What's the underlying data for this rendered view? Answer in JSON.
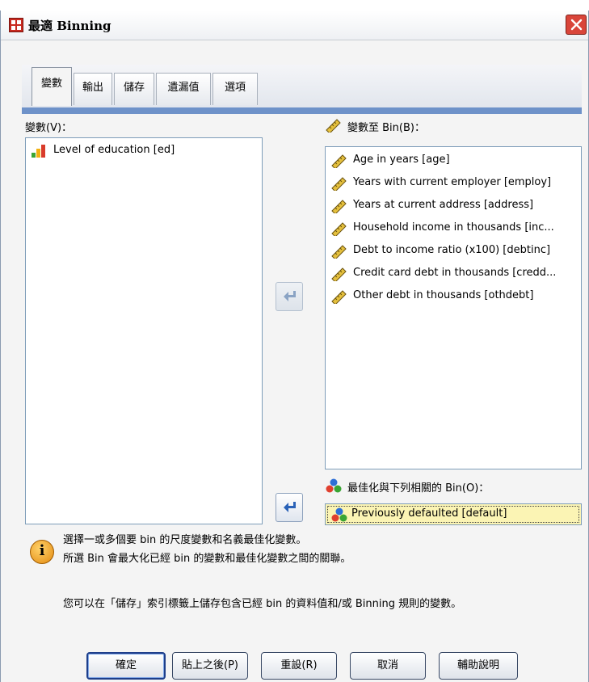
{
  "window": {
    "title": "最適 Binning",
    "close_label": "Close"
  },
  "tabs": [
    {
      "label": "變數"
    },
    {
      "label": "輸出"
    },
    {
      "label": "儲存"
    },
    {
      "label": "遺漏值"
    },
    {
      "label": "選項"
    }
  ],
  "variables": {
    "label": "變數(V)：",
    "items": [
      {
        "label": "Level of education [ed]",
        "icon": "ordinal-bar-icon"
      }
    ]
  },
  "bin": {
    "label": "變數至 Bin(B)：",
    "items": [
      {
        "label": "Age in years [age]",
        "icon": "ruler-icon"
      },
      {
        "label": "Years with current employer [employ]",
        "icon": "ruler-icon"
      },
      {
        "label": "Years at current address [address]",
        "icon": "ruler-icon"
      },
      {
        "label": "Household income in thousands [inc...",
        "icon": "ruler-icon"
      },
      {
        "label": "Debt to income ratio (x100) [debtinc]",
        "icon": "ruler-icon"
      },
      {
        "label": "Credit card debt in thousands [credd...",
        "icon": "ruler-icon"
      },
      {
        "label": "Other debt in thousands [othdebt]",
        "icon": "ruler-icon"
      }
    ]
  },
  "optimize": {
    "label": "最佳化與下列相關的 Bin(O)：",
    "value": "Previously defaulted [default]"
  },
  "info": {
    "line1": "選擇一或多個要 bin 的尺度變數和名義最佳化變數。",
    "line2": "所選 Bin 會最大化已經 bin 的變數和最佳化變數之間的關聯。",
    "line3": "您可以在「儲存」索引標籤上儲存包含已經 bin 的資料值和/或 Binning 規則的變數。"
  },
  "buttons": {
    "ok": "確定",
    "paste": "貼上之後(P)",
    "reset": "重設(R)",
    "cancel": "取消",
    "help": "輔助說明"
  },
  "colors": {
    "accent": "#6e92c9",
    "target_bg": "#fbf4b4",
    "list_border": "#7e9db9"
  }
}
